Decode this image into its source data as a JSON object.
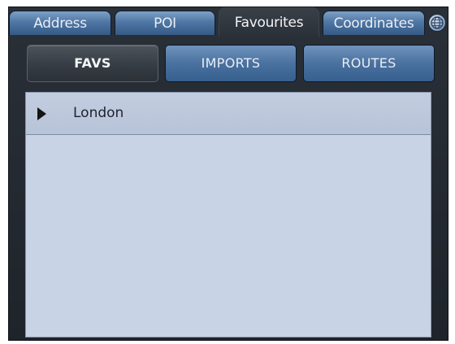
{
  "tabs": [
    {
      "label": "Address",
      "active": false
    },
    {
      "label": "POI",
      "active": false
    },
    {
      "label": "Favourites",
      "active": true
    },
    {
      "label": "Coordinates",
      "active": false
    }
  ],
  "globe_icon": "globe-icon",
  "sub_tabs": [
    {
      "label": "FAVS",
      "active": true
    },
    {
      "label": "IMPORTS",
      "active": false
    },
    {
      "label": "ROUTES",
      "active": false
    }
  ],
  "list": {
    "items": [
      {
        "label": "London",
        "icon": "play-arrow-icon"
      }
    ]
  },
  "colors": {
    "tab_blue": "#4f77a5",
    "panel": "#c8d3e6",
    "frame": "#2a3038"
  }
}
